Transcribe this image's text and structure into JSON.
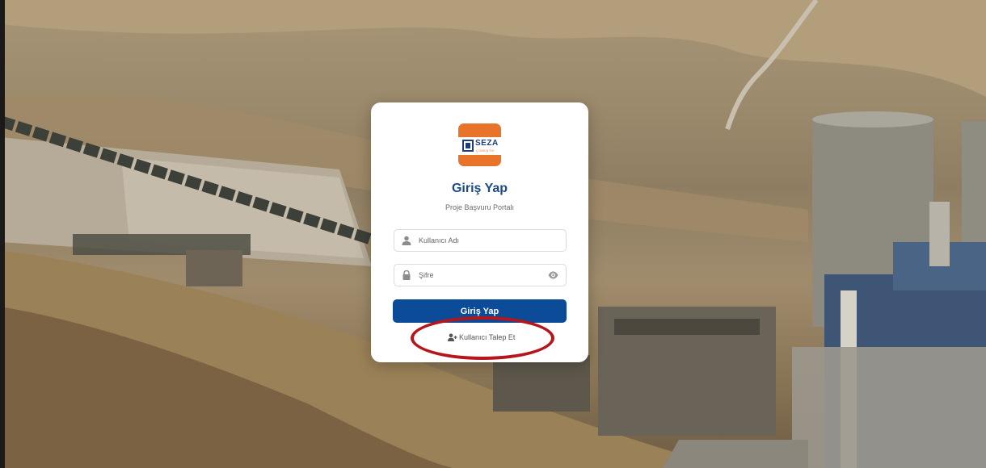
{
  "brand": {
    "logo_text": "SEZA",
    "logo_subtext": "ÇİMENTO"
  },
  "login": {
    "title": "Giriş Yap",
    "subtitle": "Proje Başvuru Portalı",
    "username_placeholder": "Kullanıcı Adı",
    "password_placeholder": "Şifre",
    "submit_label": "Giriş Yap",
    "request_user_label": "Kullanıcı Talep Et"
  },
  "icons": {
    "username": "user-icon",
    "password": "lock-icon",
    "toggle_password": "eye-icon",
    "request_user": "user-plus-icon"
  },
  "colors": {
    "brand_orange": "#e8742c",
    "brand_navy": "#1c3d7a",
    "title_blue": "#1b4a86",
    "button_blue": "#0b4b97",
    "annotation_red": "#b4161c"
  }
}
